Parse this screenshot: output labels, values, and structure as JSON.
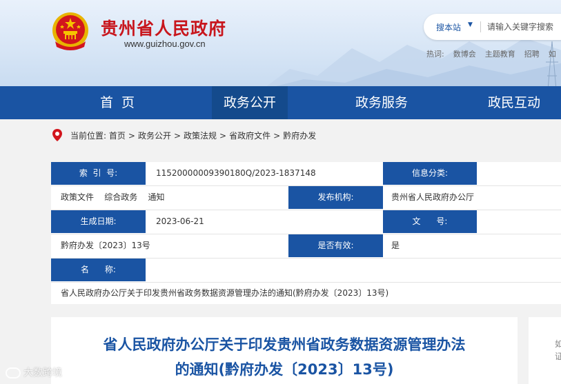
{
  "header": {
    "site_title": "贵州省人民政府",
    "site_url": "www.guizhou.gov.cn",
    "search_site": "搜本站",
    "search_placeholder": "请输入关键字搜索",
    "hot_label": "热词:",
    "hot_words": [
      "数博会",
      "主题教育",
      "招聘",
      "如"
    ]
  },
  "nav": {
    "items": [
      "首  页",
      "政务公开",
      "政务服务",
      "政民互动"
    ]
  },
  "breadcrumb": {
    "label": "当前位置:",
    "items": [
      "首页",
      "政务公开",
      "政策法规",
      "省政府文件",
      "黔府办发"
    ]
  },
  "info": {
    "index_label": "索  引  号:",
    "index_value": "11520000009390180Q/2023-1837148",
    "category_label": "信息分类:",
    "category_value": "政策文件    综合政务    通知",
    "publisher_label": "发布机构:",
    "publisher_value": "贵州省人民政府办公厅",
    "date_label": "生成日期:",
    "date_value": "2023-06-21",
    "docno_label": "文      号:",
    "docno_value": "黔府办发〔2023〕13号",
    "valid_label": "是否有效:",
    "valid_value": "是",
    "name_label": "名      称:",
    "name_value": "省人民政府办公厅关于印发贵州省政务数据资源管理办法的通知(黔府办发〔2023〕13号)"
  },
  "article": {
    "title_line1": "省人民政府办公厅关于印发贵州省政务数据资源管理办法",
    "title_line2": "的通知(黔府办发〔2023〕13号)"
  },
  "side": {
    "text": "如 证"
  },
  "watermark": "大数跨境",
  "colors": {
    "brand_blue": "#1a54a3",
    "title_red": "#c8161d",
    "nav_active": "#144a8c"
  }
}
